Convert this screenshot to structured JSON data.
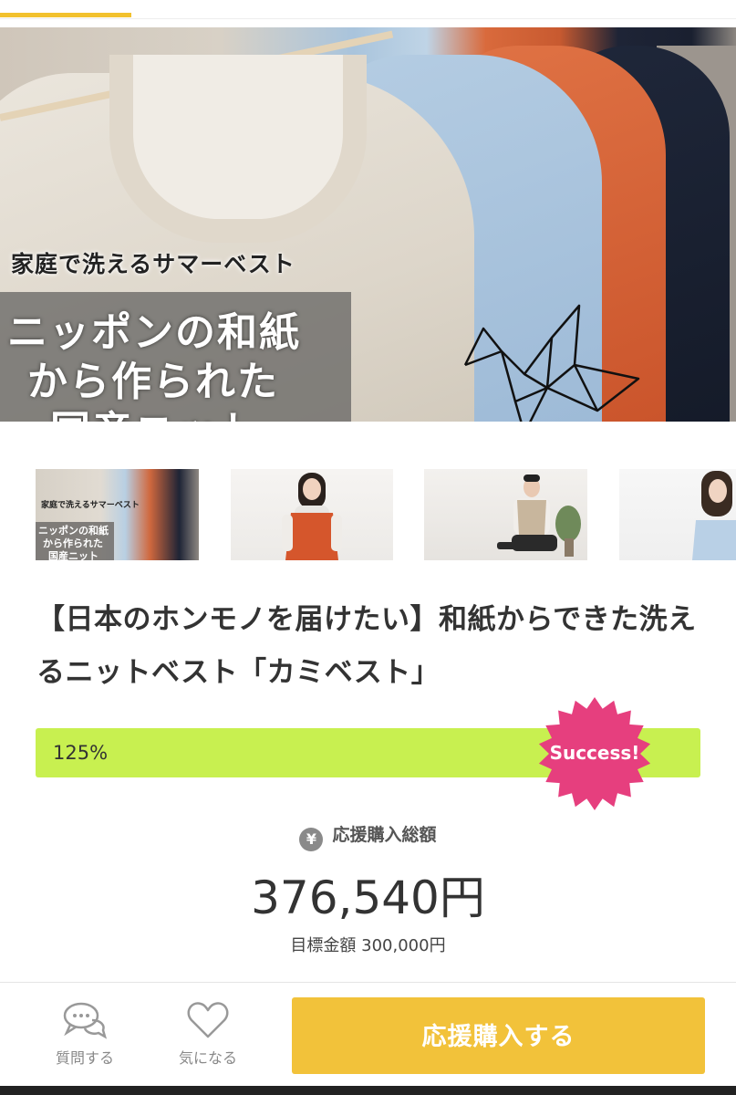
{
  "hero": {
    "subtitle": "家庭で洗えるサマーベスト",
    "title_lines": [
      "ニッポンの和紙",
      "から作られた",
      "国産ニット"
    ]
  },
  "thumbnails": {
    "first": {
      "subtitle": "家庭で洗えるサマーベスト",
      "title_lines": [
        "ニッポンの和紙",
        "から作られた",
        "国産ニット"
      ]
    }
  },
  "project": {
    "title": "【日本のホンモノを届けたい】和紙からできた洗えるニットベスト「カミベスト」"
  },
  "progress": {
    "percent_label": "125%",
    "percent_value": 125,
    "badge": "Success!",
    "colors": {
      "bar": "#c8f050",
      "badge": "#e63f7e"
    }
  },
  "totals": {
    "caption": "応援購入総額",
    "amount": "376,540円",
    "goal": "目標金額 300,000円",
    "icon": "yen-icon"
  },
  "bottom_bar": {
    "question_label": "質問する",
    "favorite_label": "気になる",
    "buy_label": "応援購入する",
    "colors": {
      "accent": "#f2c23a"
    }
  }
}
